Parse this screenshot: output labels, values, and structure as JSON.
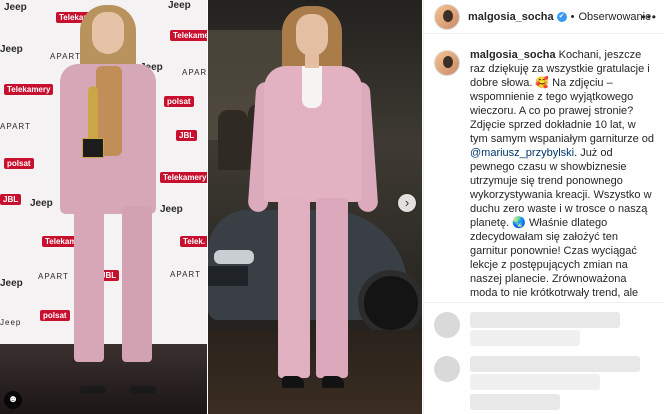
{
  "left_photo": {
    "backdrop_logos": [
      "Jeep",
      "APART",
      "Jeep",
      "APART",
      "Jeep",
      "APART",
      "Jeep",
      "APART",
      "APART",
      "Jeep",
      "Jeep",
      "JBL",
      "JBL",
      "JBL",
      "polsat",
      "polsat",
      "polsat"
    ]
  },
  "right_photo": {
    "next_label": "›"
  },
  "post": {
    "username": "malgosia_socha",
    "verified_mark": "✔",
    "separator": "•",
    "follow_label": "Obserwowanie",
    "more_label": "•••",
    "caption_user": "malgosia_socha",
    "caption_text_1": " Kochani, jeszcze raz dziękuję za wszystkie gratulacje i dobre słowa. 🥰 Na zdjęciu – wspomnienie z tego wyjątkowego wieczoru. A co po prawej stronie? Zdjęcie sprzed dokładnie 10 lat, w tym samym wspaniałym garniturze od ",
    "caption_mention": "@mariusz_przybylski",
    "caption_text_2": ". Już od pewnego czasu w showbiznesie utrzymuje się trend ponownego wykorzystywania kreacji. Wszystko w duchu zero waste i w trosce o naszą planetę. 🌏 Właśnie dlatego zdecydowałam się założyć ten garnitur ponownie! Czas wyciągać lekcje z postępujących zmian na naszej planecie. Zrównoważona moda to nie krótkotrwały trend, ale"
  }
}
